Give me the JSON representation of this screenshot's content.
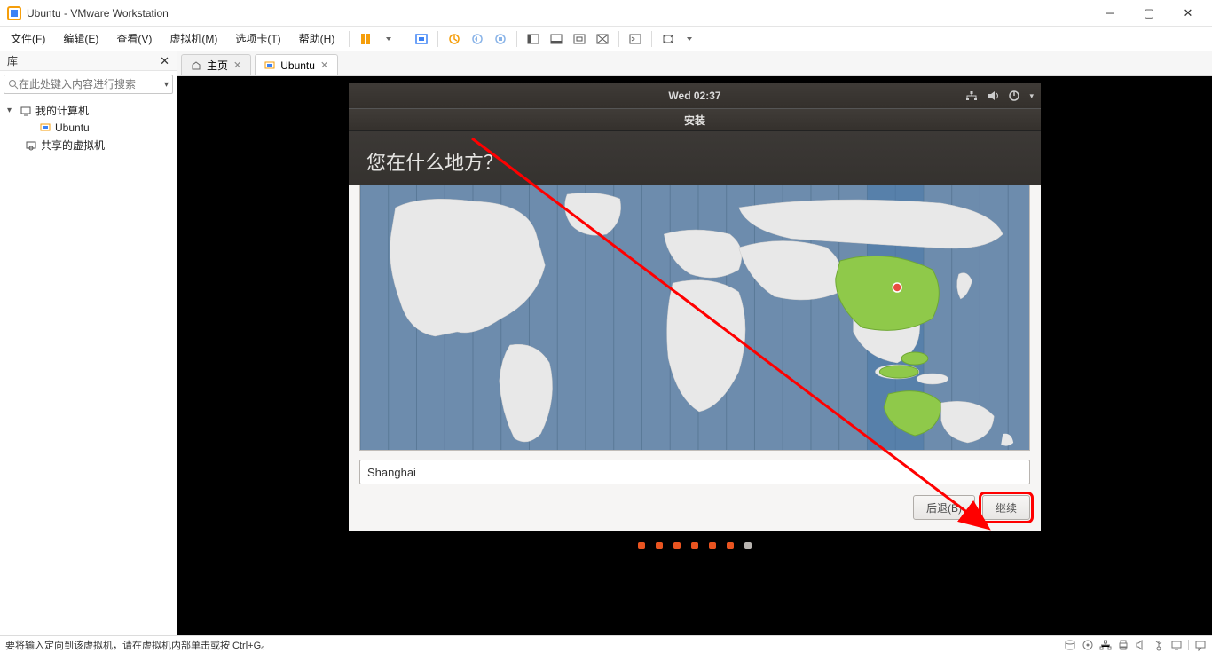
{
  "titlebar": {
    "title": "Ubuntu - VMware Workstation"
  },
  "menubar": {
    "file": "文件(F)",
    "edit": "编辑(E)",
    "view": "查看(V)",
    "vm": "虚拟机(M)",
    "tabs": "选项卡(T)",
    "help": "帮助(H)"
  },
  "sidebar": {
    "header": "库",
    "search_placeholder": "在此处键入内容进行搜索",
    "root": "我的计算机",
    "vm1": "Ubuntu",
    "shared": "共享的虚拟机"
  },
  "tabs": {
    "home": "主页",
    "ubuntu": "Ubuntu"
  },
  "ubuntu_top": {
    "clock": "Wed 02:37"
  },
  "installer": {
    "window_title": "安装",
    "heading": "您在什么地方？",
    "timezone_value": "Shanghai",
    "back_btn": "后退(B)",
    "continue_btn": "继续"
  },
  "statusbar": {
    "hint": "要将输入定向到该虚拟机，请在虚拟机内部单击或按 Ctrl+G。"
  }
}
